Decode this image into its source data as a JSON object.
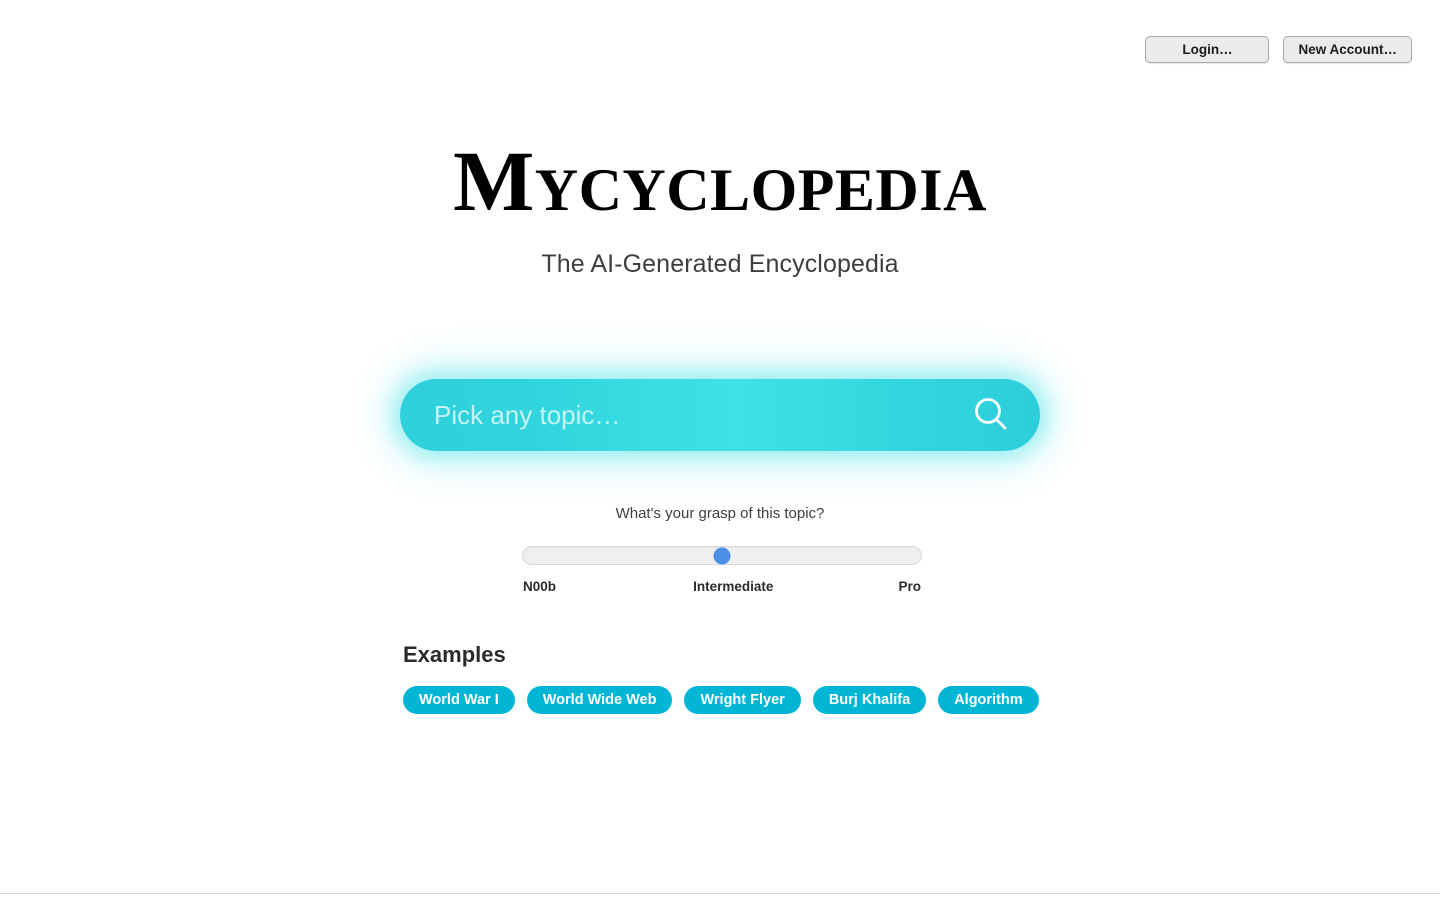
{
  "auth": {
    "login_label": "Login…",
    "new_account_label": "New Account…"
  },
  "brand": {
    "title": "Mycyclopedia",
    "subtitle": "The AI-Generated Encyclopedia"
  },
  "search": {
    "value": "",
    "placeholder": "Pick any topic…",
    "icon": "search-icon",
    "gradient_start": "#2ed0db",
    "gradient_mid": "#3ee2e4",
    "gradient_end": "#2dcedb",
    "glow_color": "#40e0e6"
  },
  "grasp": {
    "question": "What's your grasp of this topic?",
    "value": 50,
    "min": 0,
    "max": 100,
    "thumb_color": "#4a90e8",
    "track_color": "#efefef",
    "labels": {
      "low": "N00b",
      "mid": "Intermediate",
      "high": "Pro"
    }
  },
  "examples": {
    "heading": "Examples",
    "chip_color": "#00b6d4",
    "items": [
      {
        "label": "World War I"
      },
      {
        "label": "World Wide Web"
      },
      {
        "label": "Wright Flyer"
      },
      {
        "label": "Burj Khalifa"
      },
      {
        "label": "Algorithm"
      }
    ]
  }
}
